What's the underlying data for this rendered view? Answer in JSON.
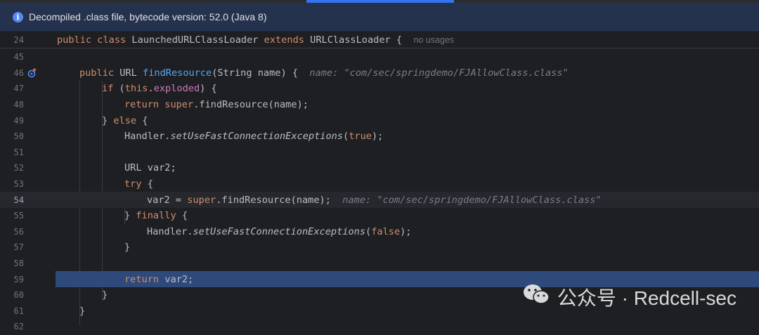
{
  "banner": {
    "icon": "info-icon",
    "text": "Decompiled .class file, bytecode version: 52.0 (Java 8)"
  },
  "sticky": {
    "number": "24",
    "kw1": "public",
    "kw2": "class",
    "name": "LaunchedURLClassLoader",
    "kw3": "extends",
    "super": "URLClassLoader {",
    "hint": "no usages"
  },
  "lines": {
    "n45": "45",
    "n46": "46",
    "n47": "47",
    "n48": "48",
    "n49": "49",
    "n50": "50",
    "n51": "51",
    "n52": "52",
    "n53": "53",
    "n54": "54",
    "n55": "55",
    "n56": "56",
    "n57": "57",
    "n58": "58",
    "n59": "59",
    "n60": "60",
    "n61": "61",
    "n62": "62"
  },
  "code": {
    "l46_kw": "public",
    "l46_type": " URL ",
    "l46_fn": "findResource",
    "l46_rest": "(String name) {",
    "l46_hint": "name: \"com/sec/springdemo/FJAllowClass.class\"",
    "l47_kw": "if",
    "l47_a": " (",
    "l47_this": "this",
    "l47_dot": ".",
    "l47_fld": "exploded",
    "l47_b": ") {",
    "l48_kw": "return",
    "l48_sp": " ",
    "l48_super": "super",
    "l48_rest": ".findResource(name);",
    "l49_a": "} ",
    "l49_kw": "else",
    "l49_b": " {",
    "l50_a": "Handler.",
    "l50_m": "setUseFastConnectionExceptions",
    "l50_b": "(",
    "l50_kw": "true",
    "l50_c": ");",
    "l52": "URL var2;",
    "l53_kw": "try",
    "l53_b": " {",
    "l54_a": "var2 = ",
    "l54_super": "super",
    "l54_rest": ".findResource(name);",
    "l54_hint": "name: \"com/sec/springdemo/FJAllowClass.class\"",
    "l55_a": "} ",
    "l55_kw": "finally",
    "l55_b": " {",
    "l56_a": "Handler.",
    "l56_m": "setUseFastConnectionExceptions",
    "l56_b": "(",
    "l56_kw": "false",
    "l56_c": ");",
    "l57": "}",
    "l59_kw": "return",
    "l59_rest": " var2;",
    "l60": "}",
    "l61": "}"
  },
  "watermark": {
    "text": "公众号 · Redcell-sec",
    "icon": "wechat-icon"
  },
  "colors": {
    "background": "#1e1f22",
    "keyword": "#cf8e6d",
    "method": "#56a8f5",
    "field": "#c77dbb",
    "exec_line": "#2d4a7a",
    "banner": "#25324d"
  }
}
